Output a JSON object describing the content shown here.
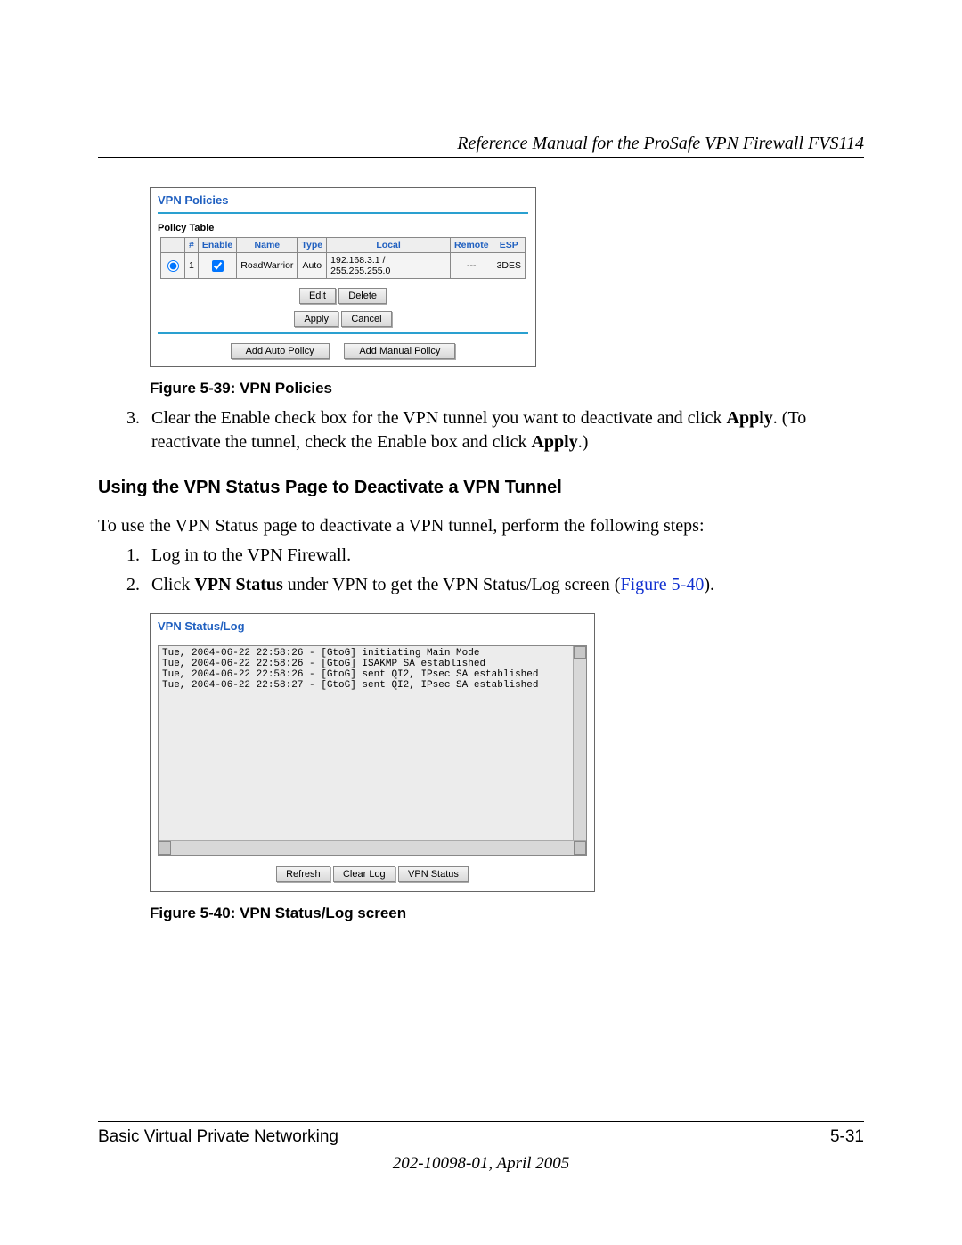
{
  "header": {
    "title": "Reference Manual for the ProSafe VPN Firewall FVS114"
  },
  "figure1": {
    "panel_title": "VPN Policies",
    "subtitle": "Policy Table",
    "columns": {
      "num": "#",
      "enable": "Enable",
      "name": "Name",
      "type": "Type",
      "local": "Local",
      "remote": "Remote",
      "esp": "ESP"
    },
    "row": {
      "num": "1",
      "name": "RoadWarrior",
      "type": "Auto",
      "local": "192.168.3.1 / 255.255.255.0",
      "remote": "---",
      "esp": "3DES"
    },
    "buttons": {
      "edit": "Edit",
      "delete": "Delete",
      "apply": "Apply",
      "cancel": "Cancel",
      "add_auto": "Add Auto Policy",
      "add_manual": "Add Manual Policy"
    },
    "caption": "Figure 5-39:  VPN Policies"
  },
  "step3": {
    "num": "3.",
    "text_a": "Clear the Enable check box for the VPN tunnel you want to deactivate and click ",
    "bold_a": "Apply",
    "text_b": ". (To reactivate the tunnel, check the Enable box and click ",
    "bold_b": "Apply",
    "text_c": ".)"
  },
  "section_heading": "Using the VPN Status Page to Deactivate a VPN Tunnel",
  "intro": "To use the VPN Status page to deactivate a VPN tunnel, perform the following steps:",
  "step1b": {
    "num": "1.",
    "text": "Log in to the VPN Firewall."
  },
  "step2b": {
    "num": "2.",
    "text_a": "Click ",
    "bold_a": "VPN Status",
    "text_b": " under VPN to get the VPN Status/Log screen (",
    "link": "Figure 5-40",
    "text_c": ")."
  },
  "figure2": {
    "panel_title": "VPN Status/Log",
    "log": "Tue, 2004-06-22 22:58:26 - [GtoG] initiating Main Mode\nTue, 2004-06-22 22:58:26 - [GtoG] ISAKMP SA established\nTue, 2004-06-22 22:58:26 - [GtoG] sent QI2, IPsec SA established\nTue, 2004-06-22 22:58:27 - [GtoG] sent QI2, IPsec SA established",
    "buttons": {
      "refresh": "Refresh",
      "clear": "Clear Log",
      "status": "VPN Status"
    },
    "caption": "Figure 5-40:  VPN Status/Log screen"
  },
  "footer": {
    "left": "Basic Virtual Private Networking",
    "right": "5-31",
    "id": "202-10098-01, April 2005"
  }
}
